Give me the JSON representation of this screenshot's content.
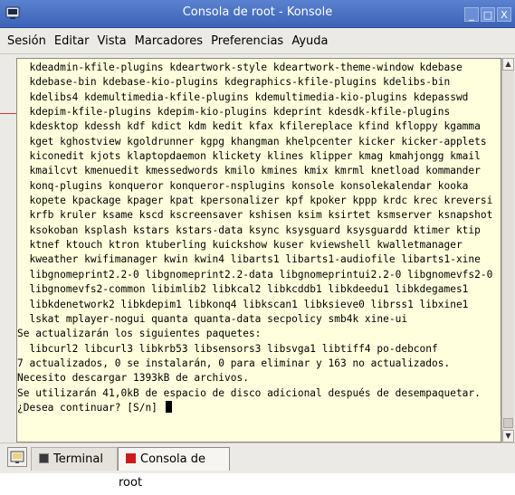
{
  "window": {
    "title": "Consola de root - Konsole",
    "buttons": {
      "minimize": "_",
      "maximize": "□",
      "close": "X"
    }
  },
  "menubar": {
    "items": [
      "Sesión",
      "Editar",
      "Vista",
      "Marcadores",
      "Preferencias",
      "Ayuda"
    ]
  },
  "terminal": {
    "lines": [
      "  kdeadmin-kfile-plugins kdeartwork-style kdeartwork-theme-window kdebase",
      "  kdebase-bin kdebase-kio-plugins kdegraphics-kfile-plugins kdelibs-bin",
      "  kdelibs4 kdemultimedia-kfile-plugins kdemultimedia-kio-plugins kdepasswd",
      "  kdepim-kfile-plugins kdepim-kio-plugins kdeprint kdesdk-kfile-plugins",
      "  kdesktop kdessh kdf kdict kdm kedit kfax kfilereplace kfind kfloppy kgamma",
      "  kget kghostview kgoldrunner kgpg khangman khelpcenter kicker kicker-applets",
      "  kiconedit kjots klaptopdaemon klickety klines klipper kmag kmahjongg kmail",
      "  kmailcvt kmenuedit kmessedwords kmilo kmines kmix kmrml knetload kommander",
      "  konq-plugins konqueror konqueror-nsplugins konsole konsolekalendar kooka",
      "  kopete kpackage kpager kpat kpersonalizer kpf kpoker kppp krdc krec kreversi",
      "  krfb kruler ksame kscd kscreensaver kshisen ksim ksirtet ksmserver ksnapshot",
      "  ksokoban ksplash kstars kstars-data ksync ksysguard ksysguardd ktimer ktip",
      "  ktnef ktouch ktron ktuberling kuickshow kuser kviewshell kwalletmanager",
      "  kweather kwifimanager kwin kwin4 libarts1 libarts1-audiofile libarts1-xine",
      "  libgnomeprint2.2-0 libgnomeprint2.2-data libgnomeprintui2.2-0 libgnomevfs2-0",
      "  libgnomevfs2-common libimlib2 libkcal2 libkcddb1 libkdeedu1 libkdegames1",
      "  libkdenetwork2 libkdepim1 libkonq4 libkscan1 libksieve0 librss1 libxine1",
      "  lskat mplayer-nogui quanta quanta-data secpolicy smb4k xine-ui",
      "Se actualizarán los siguientes paquetes:",
      "  libcurl2 libcurl3 libkrb53 libsensors3 libsvga1 libtiff4 po-debconf",
      "7 actualizados, 0 se instalarán, 0 para eliminar y 163 no actualizados.",
      "Necesito descargar 1393kB de archivos.",
      "Se utilizarán 41,0kB de espacio de disco adicional después de desempaquetar.",
      "¿Desea continuar? [S/n] "
    ]
  },
  "tabs": [
    {
      "label": "Terminal",
      "icon": "terminal-icon"
    },
    {
      "label": "Consola de root",
      "icon": "root-console-icon",
      "active": true
    }
  ],
  "colors": {
    "terminal_bg": "#ffffdd",
    "titlebar": "#4a72c4",
    "root_icon": "#cc1a1a"
  }
}
